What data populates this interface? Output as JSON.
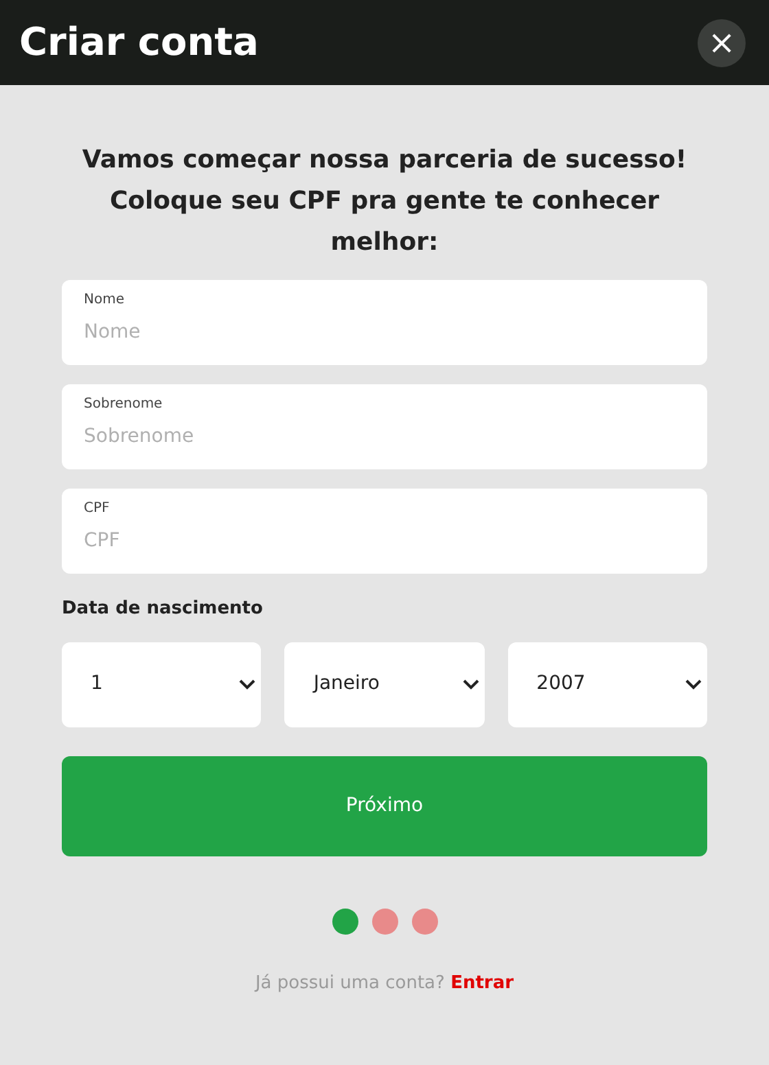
{
  "header": {
    "title": "Criar conta",
    "close_label": "×"
  },
  "intro": "Vamos começar nossa parceria de sucesso! Coloque seu CPF pra gente te conhecer melhor:",
  "fields": [
    {
      "label": "Nome",
      "placeholder": "Nome"
    },
    {
      "label": "Sobrenome",
      "placeholder": "Sobrenome"
    },
    {
      "label": "CPF",
      "placeholder": "CPF"
    }
  ],
  "birth_date": {
    "label": "Data de nascimento",
    "selects": [
      {
        "value": "1"
      },
      {
        "value": "Janeiro"
      },
      {
        "value": "2007"
      }
    ]
  },
  "next_button": "Próximo",
  "steps": [
    {
      "selected": true
    },
    {
      "selected": false
    },
    {
      "selected": false
    }
  ],
  "login_prompt": {
    "text": "Já possui uma conta?",
    "link": "Entrar"
  }
}
